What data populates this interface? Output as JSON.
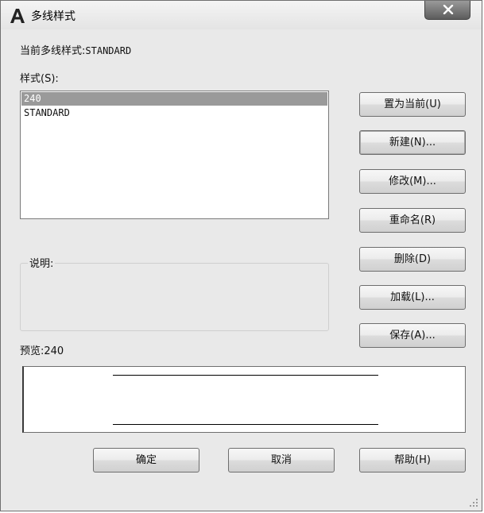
{
  "window": {
    "title": "多线样式",
    "icon": "autocad-a-icon",
    "close_icon": "close-icon"
  },
  "current_style": {
    "label": "当前多线样式:",
    "value": "STANDARD"
  },
  "styles_list": {
    "label": "样式(S):",
    "items": [
      "240",
      "STANDARD"
    ],
    "selected": "240"
  },
  "description": {
    "label": "说明:"
  },
  "preview": {
    "label": "预览:",
    "value": "240"
  },
  "side_buttons": {
    "set_current": "置为当前(U)",
    "new": "新建(N)...",
    "modify": "修改(M)...",
    "rename": "重命名(R)",
    "delete": "删除(D)",
    "load": "加载(L)...",
    "save": "保存(A)..."
  },
  "bottom_buttons": {
    "ok": "确定",
    "cancel": "取消",
    "help": "帮助(H)"
  }
}
